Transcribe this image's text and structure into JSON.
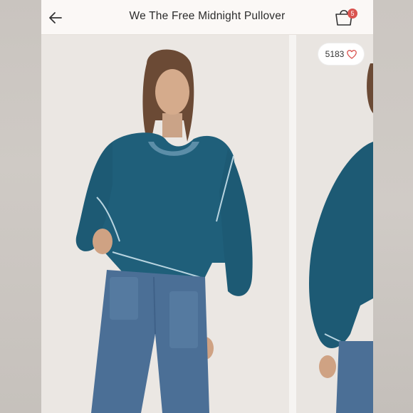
{
  "header": {
    "title": "We The Free Midnight Pullover",
    "cart_count": "5"
  },
  "likes": {
    "count": "5183"
  },
  "icons": {
    "back": "arrow-left-icon",
    "cart": "shopping-bag-icon",
    "like": "heart-icon"
  },
  "colors": {
    "sweater": "#1f5f7a",
    "pants": "#4b6f96",
    "background": "#ebe7e3",
    "badge": "#d9534f"
  }
}
